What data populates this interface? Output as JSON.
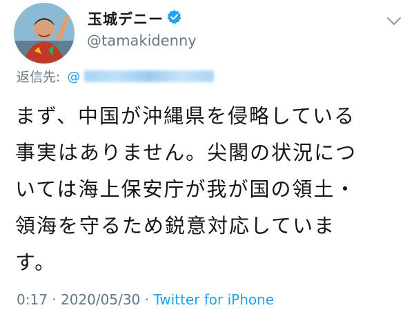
{
  "author": {
    "display_name": "玉城デニー",
    "handle": "@tamakidenny",
    "verified": true
  },
  "reply": {
    "label": "返信先:",
    "mention_prefix": "@"
  },
  "tweet": {
    "lines": [
      "まず、中国が沖縄県を侵略している",
      "事実はありません。尖閣の状況につ",
      "いては海上保安庁が我が国の領土・",
      "領海を守るため鋭意対応していま",
      "す。"
    ]
  },
  "meta": {
    "time": "0:17",
    "separator": "·",
    "date": "2020/05/30",
    "source": "Twitter for iPhone"
  },
  "colors": {
    "text": "#14171a",
    "secondary": "#657786",
    "accent": "#1da1f2"
  }
}
